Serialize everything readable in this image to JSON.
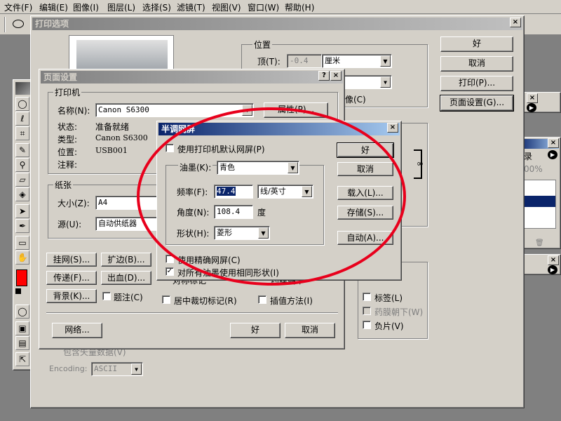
{
  "menubar": [
    "文件(F)",
    "编辑(E)",
    "图像(I)",
    "图层(L)",
    "选择(S)",
    "滤镜(T)",
    "视图(V)",
    "窗口(W)",
    "帮助(H)"
  ],
  "print_options": {
    "title": "打印选项",
    "position_label": "位置",
    "top_label": "顶(T):",
    "top_value": "-0.4",
    "unit_value": "厘米",
    "image_partial": "像(C)",
    "ok": "好",
    "cancel": "取消",
    "print": "打印(P)...",
    "page_setup": "页面设置(G)...",
    "labels_cb": "标签(L)",
    "emulsion_cb": "药膜朝下(W)",
    "negative_cb": "负片(V)",
    "include_vector": "包含矢量数据(V)",
    "encoding_label": "Encoding:",
    "encoding_value": "ASCII"
  },
  "page_setup": {
    "title": "页面设置",
    "printer_group": "打印机",
    "name_label": "名称(N):",
    "name_value": "Canon S6300",
    "properties_btn": "属性(P)...",
    "status_label": "状态:",
    "status_value": "准备就绪",
    "type_label": "类型:",
    "type_value": "Canon S6300",
    "location_label": "位置:",
    "location_value": "USB001",
    "comment_label": "注释:",
    "paper_group": "纸张",
    "size_label": "大小(Z):",
    "size_value": "A4",
    "source_label": "源(U):",
    "source_value": "自动供纸器",
    "screen_btn": "挂网(S)...",
    "border_btn": "扩边(B)...",
    "transfer_btn": "传递(F)...",
    "bleed_btn": "出血(D)...",
    "background_btn": "背景(K)...",
    "caption_cb": "题注(C)",
    "crop_marks_cb": "居中裁切标记(R)",
    "interp_cb": "插值方法(I)",
    "reg_marks_partial": "对称标记",
    "emulsion_partial": "药膜朝下",
    "network_btn": "网络...",
    "ok": "好",
    "cancel": "取消"
  },
  "halftone": {
    "title": "半调网屏",
    "use_default_cb": "使用打印机默认网屏(P)",
    "ink_label": "油墨(K):",
    "ink_value": "青色",
    "freq_label": "频率(F):",
    "freq_value": "47.4",
    "freq_unit": "线/英寸",
    "angle_label": "角度(N):",
    "angle_value": "108.4",
    "angle_unit": "度",
    "shape_label": "形状(H):",
    "shape_value": "菱形",
    "accurate_cb": "使用精确网屏(C)",
    "same_shape_cb": "对所有油墨使用相同形状(I)",
    "ok": "好",
    "cancel": "取消",
    "load": "载入(L)...",
    "save": "存储(S)...",
    "auto": "自动(A)...",
    "check_mark": "✓"
  },
  "panels": {
    "history_partial": "录",
    "zoom_partial": "00%"
  },
  "colors": {
    "annotation": "#e8001c",
    "foreground": "#ff0000",
    "titlebar": "#0a246a"
  }
}
